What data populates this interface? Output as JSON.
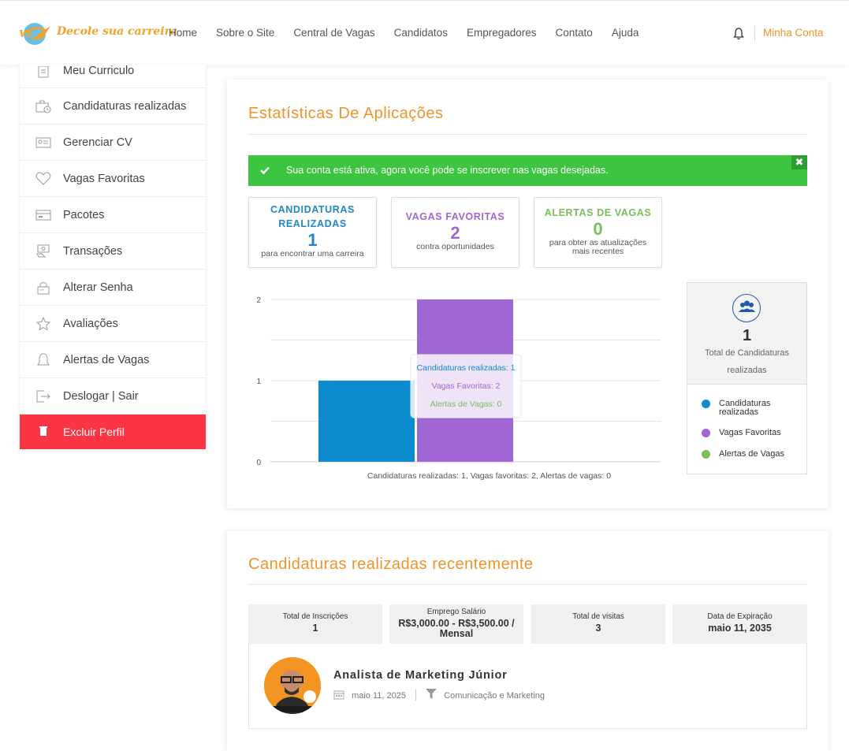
{
  "header": {
    "logo_text": "Decole sua carreira",
    "nav": [
      "Home",
      "Sobre o Site",
      "Central de Vagas",
      "Candidatos",
      "Empregadores",
      "Contato",
      "Ajuda"
    ],
    "account_label": "Minha Conta",
    "accent": "#f0932a"
  },
  "sidebar": {
    "items": [
      {
        "label": "Meu Curriculo",
        "icon": "resume-icon"
      },
      {
        "label": "Candidaturas realizadas",
        "icon": "briefcase-clock-icon"
      },
      {
        "label": "Gerenciar CV",
        "icon": "id-card-icon"
      },
      {
        "label": "Vagas Favoritas",
        "icon": "heart-icon"
      },
      {
        "label": "Pacotes",
        "icon": "package-card-icon"
      },
      {
        "label": "Transações",
        "icon": "transaction-icon"
      },
      {
        "label": "Alterar Senha",
        "icon": "password-icon"
      },
      {
        "label": "Avaliações",
        "icon": "star-icon"
      },
      {
        "label": "Alertas de Vagas",
        "icon": "bell-icon"
      },
      {
        "label": "Deslogar | Sair",
        "icon": "logout-icon"
      }
    ],
    "delete_label": "Excluir Perfil",
    "delete_color": "#fc3545"
  },
  "stats_card": {
    "title": "Estatísticas De Aplicações",
    "alert": {
      "message": "Sua conta está ativa, agora você pode se inscrever nas vagas desejadas.",
      "close": "✖",
      "color": "#3dc440"
    },
    "boxes": [
      {
        "title": "CANDIDATURAS REALIZADAS",
        "value": "1",
        "desc": "para encontrar uma carreira",
        "color": "#1e88c8"
      },
      {
        "title": "VAGAS FAVORITAS",
        "value": "2",
        "desc": "contra oportunidades",
        "color": "#a066d3"
      },
      {
        "title": "ALERTAS DE VAGAS",
        "value": "0",
        "desc": "para obter as atualizações mais recentes",
        "color": "#7cbd5a"
      }
    ],
    "side_total": {
      "value": "1",
      "label": "Total de Candidaturas realizadas"
    },
    "legend": [
      {
        "label": "Candidaturas realizadas",
        "color": "#0d8bcf"
      },
      {
        "label": "Vagas Favoritas",
        "color": "#a066d3"
      },
      {
        "label": "Alertas de Vagas",
        "color": "#7cbd5a"
      }
    ]
  },
  "chart_data": {
    "type": "bar",
    "categories": [
      "Candidaturas realizadas",
      "Vagas Favoritas",
      "Alertas de Vagas"
    ],
    "values": [
      1,
      2,
      0
    ],
    "colors": [
      "#0d8bcf",
      "#a066d3",
      "#7cbd5a"
    ],
    "yticks": [
      "0",
      "1",
      "2"
    ],
    "ylim": [
      0,
      2
    ],
    "xlabel": "Candidaturas realizadas: 1, Vagas favoritas: 2, Alertas de vagas: 0",
    "tooltip": [
      "Candidaturas realizadas: 1",
      "Vagas Favoritas: 2",
      "Alertas de Vagas: 0"
    ],
    "grid": true
  },
  "recent_card": {
    "title": "Candidaturas realizadas recentemente",
    "info": [
      {
        "header": "Total de Inscrições",
        "value": "1"
      },
      {
        "header": "Emprego Salário",
        "value": "R$3,000.00 - R$3,500.00 / Mensal"
      },
      {
        "header": "Total de visitas",
        "value": "3"
      },
      {
        "header": "Data de Expiração",
        "value": "maio 11, 2035"
      }
    ],
    "job": {
      "title": "Analista de Marketing Júnior",
      "date": "maio 11, 2025",
      "category": "Comunicação e Marketing"
    }
  }
}
